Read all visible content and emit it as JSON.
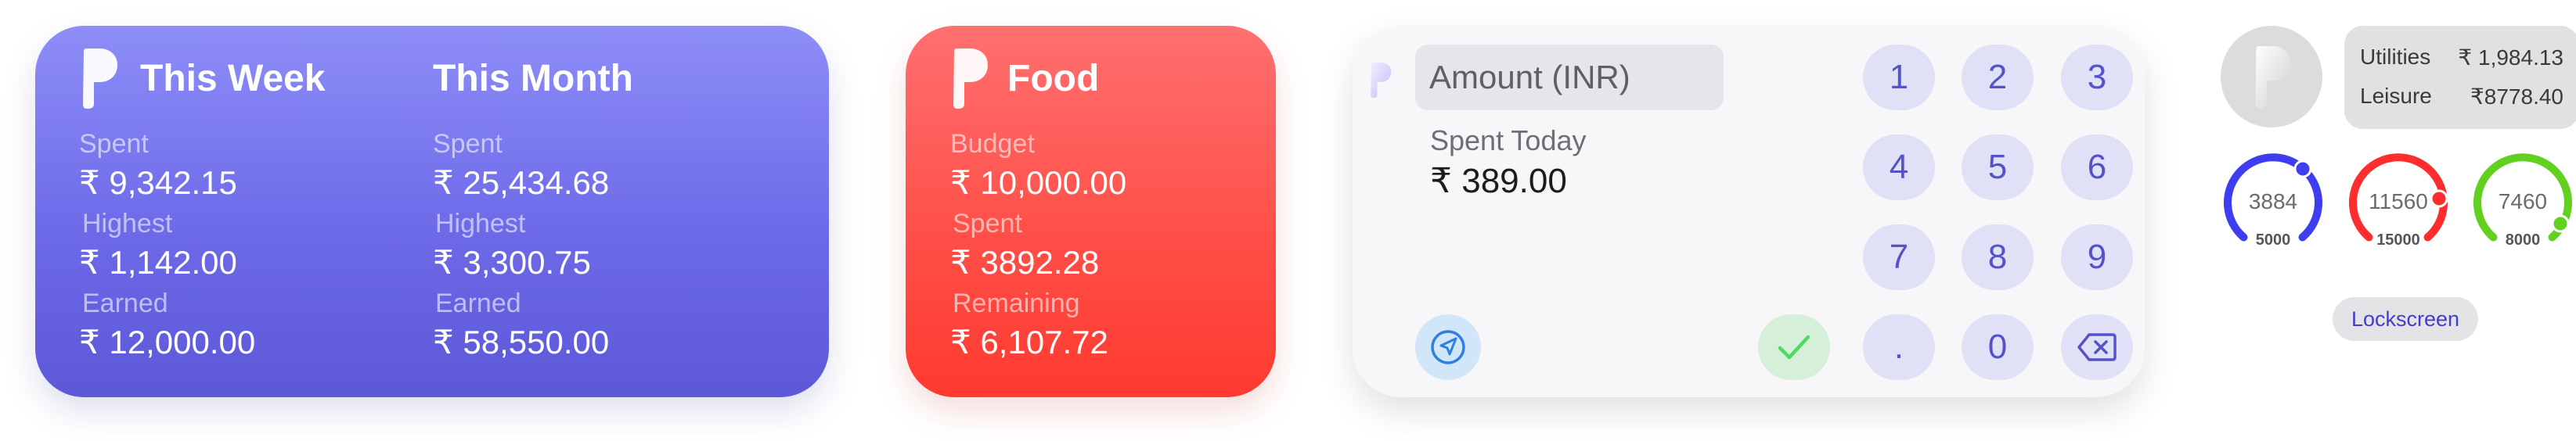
{
  "week_widget": {
    "this_week": {
      "title": "This Week",
      "spent_label": "Spent",
      "spent_value": "₹ 9,342.15",
      "highest_label": "Highest",
      "highest_value": "₹ 1,142.00",
      "earned_label": "Earned",
      "earned_value": "₹ 12,000.00"
    },
    "this_month": {
      "title": "This Month",
      "spent_label": "Spent",
      "spent_value": "₹ 25,434.68",
      "highest_label": "Highest",
      "highest_value": "₹ 3,300.75",
      "earned_label": "Earned",
      "earned_value": "₹ 58,550.00"
    },
    "colors": {
      "background_top": "#8e8ef8",
      "background_bottom": "#5c58d8"
    }
  },
  "food_widget": {
    "title": "Food",
    "budget_label": "Budget",
    "budget_value": "₹ 10,000.00",
    "spent_label": "Spent",
    "spent_value": "₹ 3892.28",
    "remaining_label": "Remaining",
    "remaining_value": "₹ 6,107.72",
    "colors": {
      "background_top": "#ff7070",
      "background_bottom": "#ff3a30"
    }
  },
  "entry_widget": {
    "amount_placeholder": "Amount (INR)",
    "spent_today_label": "Spent Today",
    "spent_today_value": "₹ 389.00",
    "keys": [
      "1",
      "2",
      "3",
      "4",
      "5",
      "6",
      "7",
      "8",
      "9",
      ".",
      "0"
    ],
    "icons": {
      "location": "location-arrow-icon",
      "confirm": "checkmark-icon",
      "delete": "backspace-icon"
    },
    "colors": {
      "key_bg": "#e0e0f6",
      "key_text": "#5553c8",
      "confirm_bg": "#d6efd8",
      "confirm_icon": "#4cd964",
      "location_bg": "#d2e6fa",
      "location_icon": "#2f7fe0"
    }
  },
  "lockscreen": {
    "categories": [
      {
        "label": "Utilities",
        "value": "₹ 1,984.13"
      },
      {
        "label": "Leisure",
        "value": "₹8778.40"
      }
    ],
    "gauges": [
      {
        "value": "3884",
        "max": "5000",
        "color": "#3f3df0"
      },
      {
        "value": "11560",
        "max": "15000",
        "color": "#ff2d2d"
      },
      {
        "value": "7460",
        "max": "8000",
        "color": "#62d01e"
      }
    ],
    "label": "Lockscreen"
  }
}
